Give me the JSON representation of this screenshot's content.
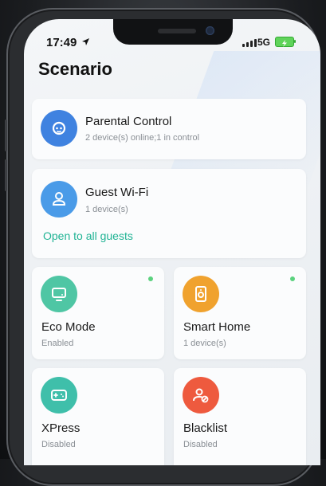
{
  "status": {
    "time": "17:49",
    "network": "5G"
  },
  "page": {
    "title": "Scenario"
  },
  "parental": {
    "title": "Parental Control",
    "subtitle": "2 device(s) online;1 in control"
  },
  "guest": {
    "title": "Guest Wi-Fi",
    "subtitle": "1 device(s)",
    "link": "Open to all guests"
  },
  "tiles": [
    {
      "title": "Eco Mode",
      "subtitle": "Enabled"
    },
    {
      "title": "Smart Home",
      "subtitle": "1 device(s)"
    },
    {
      "title": "XPress",
      "subtitle": "Disabled"
    },
    {
      "title": "Blacklist",
      "subtitle": "Disabled"
    }
  ],
  "colors": {
    "parental_icon": "#3f82e0",
    "guest_icon": "#4a9be8",
    "eco_icon": "#4fc6a4",
    "smart_home_icon": "#f0a22e",
    "xpress_icon": "#3fbfaa",
    "blacklist_icon": "#ee5a3e",
    "link": "#20b394",
    "online_dot": "#5bd27e"
  },
  "icons": {
    "parental": "child-face-icon",
    "guest": "person-icon",
    "eco": "monitor-icon",
    "smart_home": "smart-device-icon",
    "xpress": "gamepad-icon",
    "blacklist": "blocked-user-icon"
  }
}
